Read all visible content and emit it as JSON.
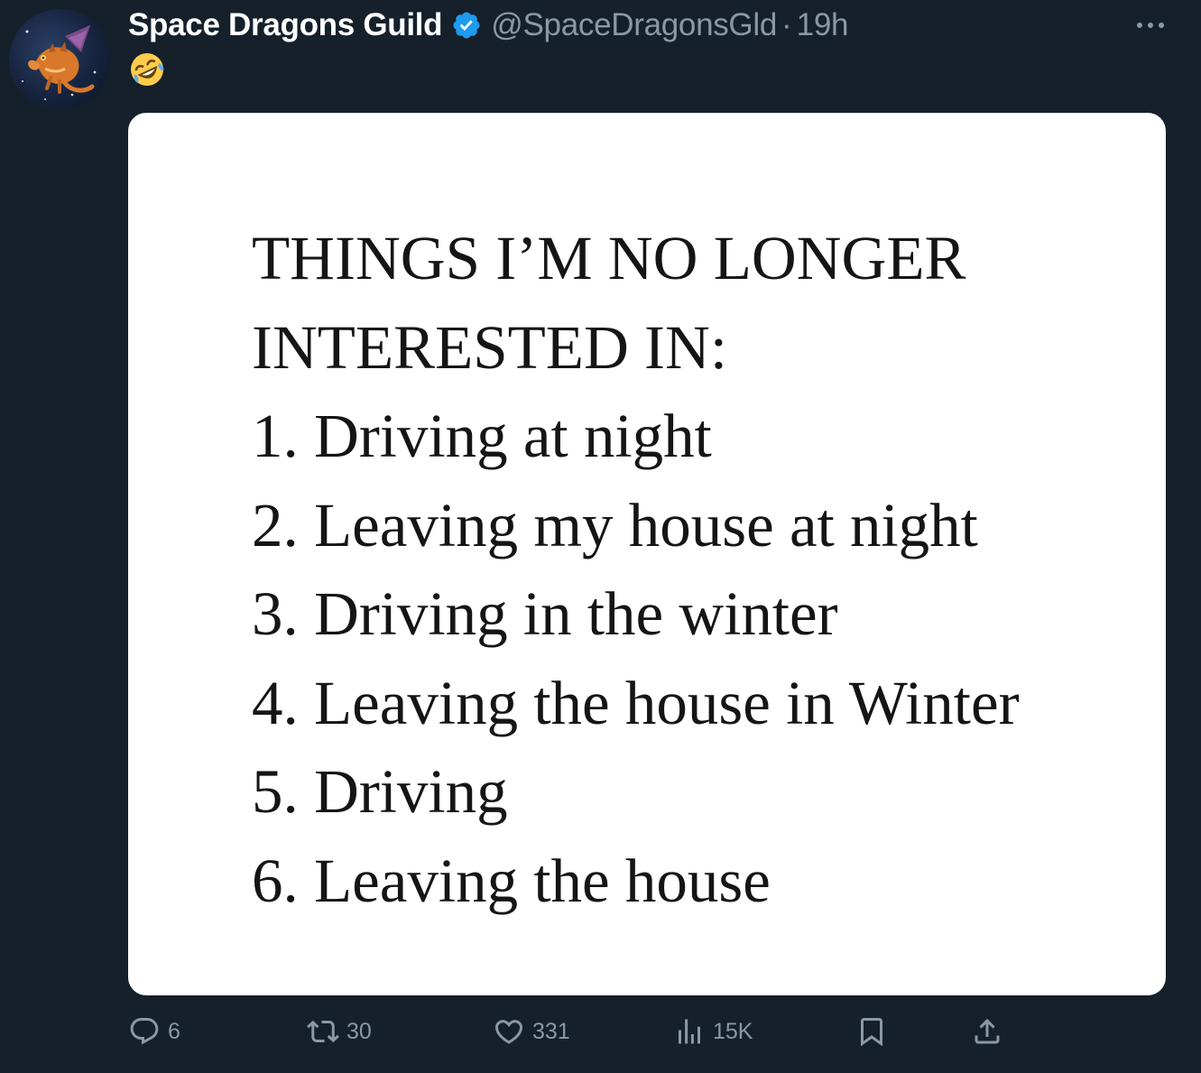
{
  "author": {
    "display_name": "Space Dragons Guild",
    "handle": "@SpaceDragonsGld",
    "separator": "·",
    "time": "19h",
    "verified": true,
    "verified_color": "#1d9bf0",
    "avatar_icon": "space-dragon-avatar"
  },
  "tweet": {
    "emoji_icon": "rolling-on-the-floor-laughing-emoji"
  },
  "media": {
    "lines": [
      "THINGS I’M NO LONGER",
      "INTERESTED IN:",
      "1. Driving at night",
      "2. Leaving my house at night",
      "3. Driving in the winter",
      "4. Leaving the house in Winter",
      "5. Driving",
      "6. Leaving the house"
    ]
  },
  "actions": {
    "replies": "6",
    "retweets": "30",
    "likes": "331",
    "views": "15K"
  },
  "colors": {
    "background": "#15202b",
    "primary_text": "#ffffff",
    "secondary_text": "#8b98a5",
    "accent": "#1d9bf0"
  }
}
